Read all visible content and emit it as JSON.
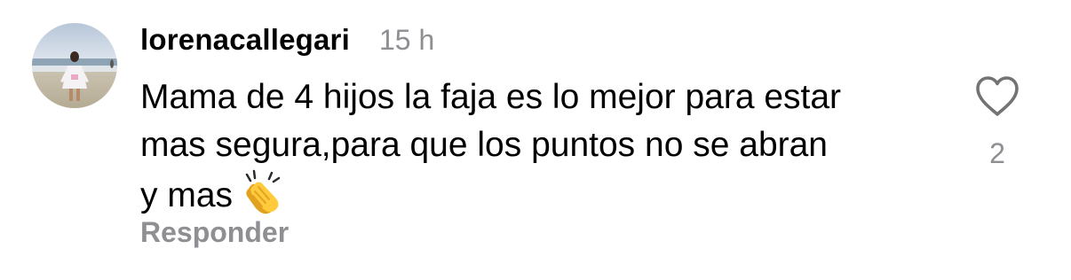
{
  "comment": {
    "username": "lorenacallegari",
    "timestamp": "15 h",
    "text_lines": [
      "Mama de 4 hijos la faja es lo mejor para estar",
      "mas segura,para que los puntos no se abran",
      "y mas"
    ],
    "emoji": "clapping-hands-emoji",
    "reply_label": "Responder",
    "like_count": "2",
    "like_icon": "heart-outline-icon"
  },
  "colors": {
    "primary_text": "#000000",
    "secondary_text": "#8e8e93",
    "background": "#ffffff"
  }
}
